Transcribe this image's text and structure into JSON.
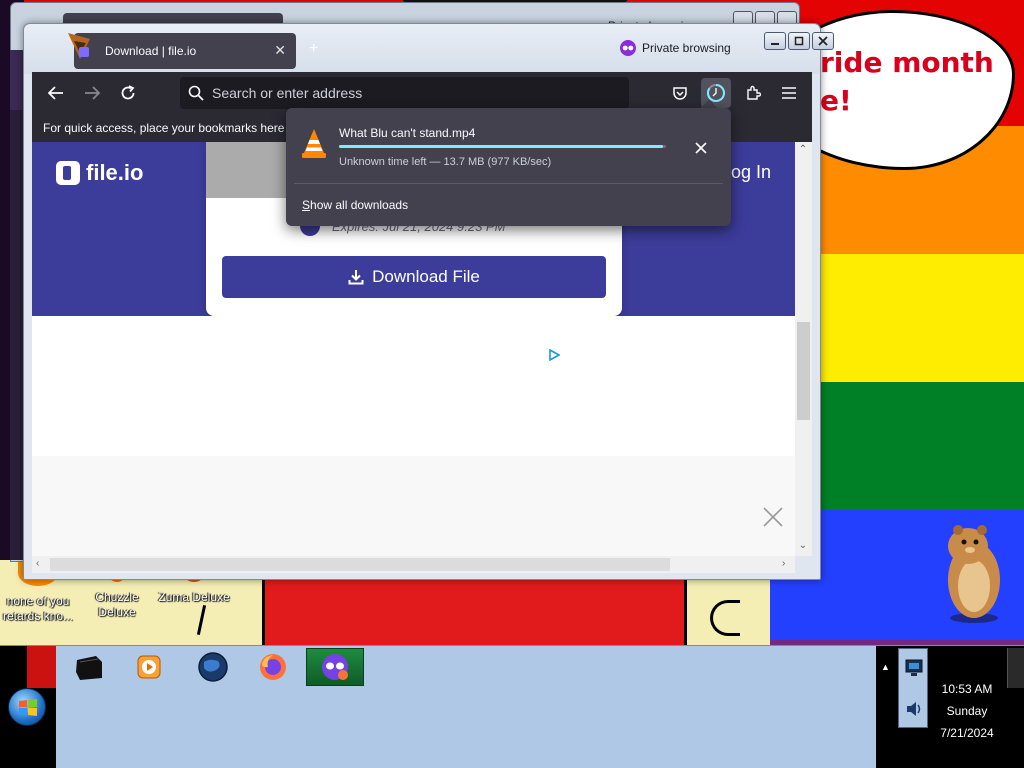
{
  "desktop": {
    "speech_bubble_text": "ride month\ne!",
    "icons": [
      {
        "label": "none of you retards kno...",
        "name": "desktop-icon-none-of-you"
      },
      {
        "label": "Chuzzle Deluxe",
        "name": "desktop-icon-chuzzle-deluxe"
      },
      {
        "label": "Zuma Deluxe",
        "name": "desktop-icon-zuma-deluxe"
      }
    ]
  },
  "background_window": {
    "private_badge": "Private browsing"
  },
  "browser": {
    "tab": {
      "title": "Download | file.io",
      "close_icon": "close-icon"
    },
    "private_badge": "Private browsing",
    "window_controls": {
      "minimize": "minimize-icon",
      "maximize": "maximize-icon",
      "close": "close-icon"
    },
    "urlbar": {
      "placeholder": "Search or enter address"
    },
    "bookmarks_bar_text": "For quick access, place your bookmarks here o"
  },
  "page": {
    "logo_text": "file.io",
    "login_text": "og In",
    "expiry_text": "Expires: Jul 21, 2024 9:23 PM",
    "download_button": "Download File"
  },
  "downloads_panel": {
    "file_name": "What Blu can't stand.mp4",
    "status": "Unknown time left — 13.7 MB (977 KB/sec)",
    "progress_fraction": 0.99,
    "show_all_access_key": "S",
    "show_all_rest": "how all downloads",
    "accent_color": "#80ebff"
  },
  "taskbar": {
    "apps": [
      {
        "name": "taskbar-app-dark-icon"
      },
      {
        "name": "taskbar-app-media-player-icon"
      },
      {
        "name": "taskbar-app-globe-icon"
      },
      {
        "name": "taskbar-app-firefox-icon"
      },
      {
        "name": "taskbar-app-firefox-private-icon"
      }
    ],
    "clock": {
      "time": "10:53 AM",
      "day": "Sunday",
      "date": "7/21/2024"
    }
  }
}
